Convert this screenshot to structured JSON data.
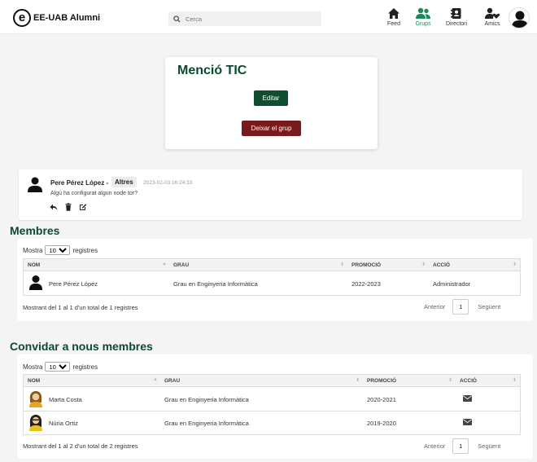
{
  "header": {
    "logo_letter": "e",
    "app_name": "EE-UAB Alumni",
    "search_placeholder": "Cerca",
    "nav": [
      {
        "label": "Feed",
        "icon": "home-icon"
      },
      {
        "label": "Grups",
        "icon": "group-icon",
        "active": true
      },
      {
        "label": "Directori",
        "icon": "directory-icon"
      },
      {
        "label": "Amics",
        "icon": "friends-icon"
      }
    ]
  },
  "group": {
    "title": "Menció TIC",
    "edit_label": "Editar",
    "leave_label": "Deixar el grup"
  },
  "post": {
    "author": "Pere Pérez López -",
    "badge": "Altres",
    "date": "2023-02-03 16:24:33",
    "body": "Algú ha configurat algun node tor?"
  },
  "members": {
    "heading": "Membres",
    "length_prefix": "Mostra",
    "length_value": "10",
    "length_suffix": "registres",
    "columns": [
      "NOM",
      "GRAU",
      "PROMOCIÓ",
      "ACCIÓ"
    ],
    "rows": [
      {
        "name": "Pere Pérez López",
        "degree": "Grau en Enginyeria Informàtica",
        "year": "2022-2023",
        "action": "Administrador"
      }
    ],
    "info": "Mostrant del 1 al 1 d'un total de 1 registres",
    "prev": "Anterior",
    "page": "1",
    "next": "Següent"
  },
  "invite": {
    "heading": "Convidar a nous membres",
    "length_prefix": "Mostra",
    "length_value": "10",
    "length_suffix": "registres",
    "columns": [
      "NOM",
      "GRAU",
      "PROMOCIÓ",
      "ACCIÓ"
    ],
    "rows": [
      {
        "name": "Marta Costa",
        "degree": "Grau en Enginyeria Informàtica",
        "year": "2020-2021",
        "action_icon": "envelope-icon"
      },
      {
        "name": "Núria Ortiz",
        "degree": "Grau en Enginyeria Informàtica",
        "year": "2019-2020",
        "action_icon": "envelope-icon"
      }
    ],
    "info": "Mostrant del 1 al 2 d'un total de 2 registres",
    "prev": "Anterior",
    "page": "1",
    "next": "Següent"
  },
  "colors": {
    "brand_green": "#0c4a2e",
    "active_nav": "#1a8a5a",
    "danger": "#7a1a1a"
  }
}
